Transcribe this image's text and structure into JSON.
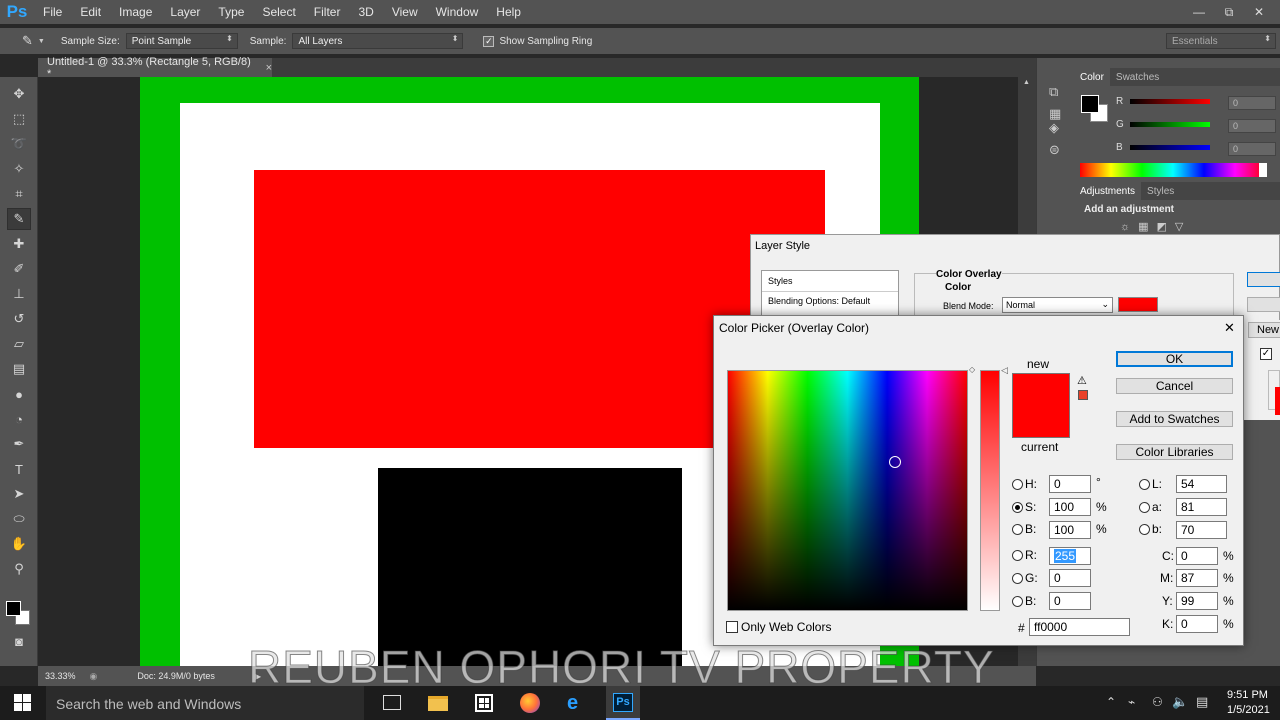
{
  "app": {
    "logo": "Ps"
  },
  "menu": [
    "File",
    "Edit",
    "Image",
    "Layer",
    "Type",
    "Select",
    "Filter",
    "3D",
    "View",
    "Window",
    "Help"
  ],
  "window_controls": {
    "minimize": "—",
    "restore": "⧉",
    "close": "✕"
  },
  "options": {
    "sample_size_label": "Sample Size:",
    "sample_size_value": "Point Sample",
    "sample_label": "Sample:",
    "sample_value": "All Layers",
    "show_ring_label": "Show Sampling Ring",
    "show_ring_checked": true,
    "workspace": "Essentials"
  },
  "document": {
    "tab_title": "Untitled-1 @ 33.3% (Rectangle 5, RGB/8) *",
    "close": "×",
    "zoom": "33.33%",
    "doc_info": "Doc: 24.9M/0 bytes",
    "colors": {
      "frame": "#00c000",
      "inner": "#ffffff",
      "red": "#ff0000",
      "black": "#000000"
    }
  },
  "panels": {
    "color_tabs": [
      "Color",
      "Swatches"
    ],
    "rgb_labels": [
      "R",
      "G",
      "B"
    ],
    "rgb_values": [
      "0",
      "0",
      "0"
    ],
    "adj_tabs": [
      "Adjustments",
      "Styles"
    ],
    "add_adjustment": "Add an adjustment"
  },
  "layer_style": {
    "title": "Layer Style",
    "list": [
      "Styles",
      "Blending Options: Default"
    ],
    "section": "Color Overlay",
    "subsection": "Color",
    "blend_mode_label": "Blend Mode:",
    "blend_mode_value": "Normal",
    "swatch_color": "#ff0000",
    "right_partial": [
      "New"
    ]
  },
  "color_picker": {
    "title": "Color Picker (Overlay Color)",
    "close": "✕",
    "new_label": "new",
    "current_label": "current",
    "new_color": "#ff0000",
    "current_color": "#ff0000",
    "buttons": {
      "ok": "OK",
      "cancel": "Cancel",
      "add_swatches": "Add to Swatches",
      "libraries": "Color Libraries"
    },
    "only_web_colors": "Only Web Colors",
    "hsb": [
      {
        "label": "H:",
        "value": "0",
        "unit": "°",
        "selected": false
      },
      {
        "label": "S:",
        "value": "100",
        "unit": "%",
        "selected": true
      },
      {
        "label": "B:",
        "value": "100",
        "unit": "%",
        "selected": false
      }
    ],
    "rgb": [
      {
        "label": "R:",
        "value": "255"
      },
      {
        "label": "G:",
        "value": "0"
      },
      {
        "label": "B:",
        "value": "0"
      }
    ],
    "lab": [
      {
        "label": "L:",
        "value": "54"
      },
      {
        "label": "a:",
        "value": "81"
      },
      {
        "label": "b:",
        "value": "70"
      }
    ],
    "cmyk": [
      {
        "label": "C:",
        "value": "0",
        "unit": "%"
      },
      {
        "label": "M:",
        "value": "87",
        "unit": "%"
      },
      {
        "label": "Y:",
        "value": "99",
        "unit": "%"
      },
      {
        "label": "K:",
        "value": "0",
        "unit": "%"
      }
    ],
    "hex_label": "#",
    "hex_value": "ff0000"
  },
  "watermark": "REUBEN OPHORI TV PROPERTY",
  "taskbar": {
    "search_placeholder": "Search the web and Windows",
    "time": "9:51 PM",
    "date": "1/5/2021",
    "apps": [
      "task-view",
      "file-explorer",
      "store",
      "firefox",
      "edge",
      "photoshop"
    ]
  }
}
